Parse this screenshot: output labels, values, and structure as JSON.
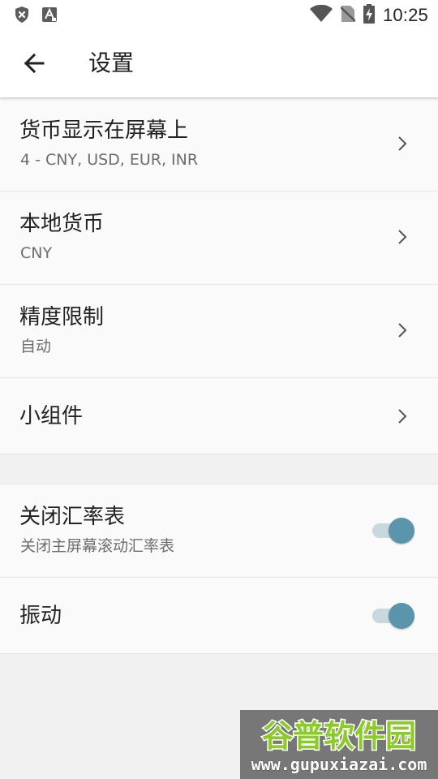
{
  "status_bar": {
    "time": "10:25",
    "left_icons": [
      "shield-x-icon",
      "app-a-icon"
    ],
    "right_icons": [
      "wifi-icon",
      "no-sim-icon",
      "battery-charging-icon"
    ]
  },
  "app_bar": {
    "back_icon": "arrow-left-icon",
    "title": "设置"
  },
  "settings": {
    "items": [
      {
        "title": "货币显示在屏幕上",
        "subtitle": "4 - CNY, USD, EUR, INR"
      },
      {
        "title": "本地货币",
        "subtitle": "CNY"
      },
      {
        "title": "精度限制",
        "subtitle": "自动"
      },
      {
        "title": "小组件"
      }
    ],
    "toggles": [
      {
        "title": "关闭汇率表",
        "subtitle": "关闭主屏幕滚动汇率表",
        "enabled": true
      },
      {
        "title": "振动",
        "enabled": true
      }
    ]
  },
  "watermark": {
    "brand_text": "谷普软件园",
    "url": "www.gupuxiazai.com"
  },
  "colors": {
    "toggle_thumb": "#5b95ab",
    "toggle_track": "#c8d8df",
    "watermark_green": "#8bcb27"
  }
}
